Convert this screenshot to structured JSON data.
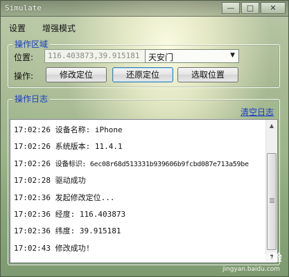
{
  "window": {
    "title": "Simulate",
    "minimize_glyph": "—",
    "maximize_glyph": "□",
    "close_glyph": "✕"
  },
  "menu": [
    {
      "label": "设置"
    },
    {
      "label": "增强模式"
    }
  ],
  "operation_area": {
    "title": "操作区域",
    "position_label": "位置:",
    "position_value": "116.403873,39.915181",
    "location_select": {
      "value": "天安门"
    },
    "operation_label": "操作:",
    "buttons": {
      "modify": "修改定位",
      "restore": "还原定位",
      "pick": "选取位置"
    }
  },
  "log_area": {
    "title": "操作日志",
    "clear_link": "清空日志",
    "entries": [
      {
        "time": "17:02:26",
        "text": "设备名称: iPhone"
      },
      {
        "time": "17:02:26",
        "text": "系统版本: 11.4.1"
      },
      {
        "time": "17:02:26",
        "text": "设备标识: 6ec08r68d513331b939606b9fcbd087e713a59be"
      },
      {
        "time": "17:02:28",
        "text": "驱动成功"
      },
      {
        "time": "17:02:36",
        "text": "发起修改定位..."
      },
      {
        "time": "17:02:36",
        "text": "经度: 116.403873"
      },
      {
        "time": "17:02:36",
        "text": "纬度: 39.915181"
      },
      {
        "time": "17:02:43",
        "text": "修改成功!"
      }
    ]
  },
  "watermark": {
    "logo": "Baidu 经验",
    "url": "jingyan.baidu.com"
  }
}
